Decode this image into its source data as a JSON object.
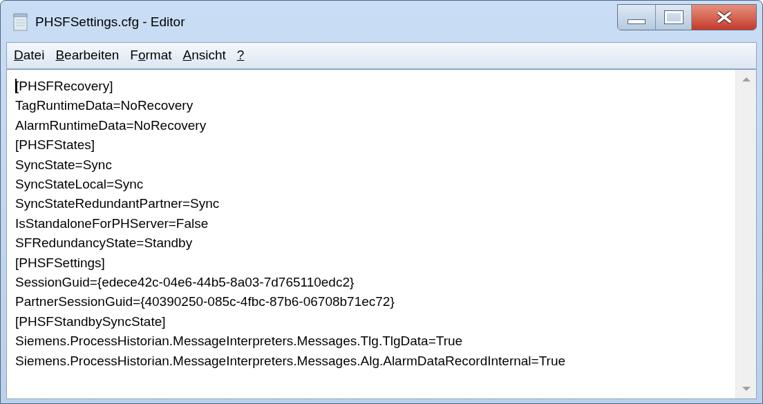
{
  "window": {
    "title": "PHSFSettings.cfg - Editor"
  },
  "menu": [
    {
      "access_key": "D",
      "label_rest": "atei"
    },
    {
      "access_key": "B",
      "label_rest": "earbeiten"
    },
    {
      "label_start": "F",
      "access_key": "o",
      "label_rest": "rmat"
    },
    {
      "access_key": "A",
      "label_rest": "nsicht"
    },
    {
      "access_key": "?"
    }
  ],
  "editor": {
    "lines": [
      "[PHSFRecovery]",
      "TagRuntimeData=NoRecovery",
      "AlarmRuntimeData=NoRecovery",
      "[PHSFStates]",
      "SyncState=Sync",
      "SyncStateLocal=Sync",
      "SyncStateRedundantPartner=Sync",
      "IsStandaloneForPHServer=False",
      "SFRedundancyState=Standby",
      "[PHSFSettings]",
      "SessionGuid={edece42c-04e6-44b5-8a03-7d765110edc2}",
      "PartnerSessionGuid={40390250-085c-4fbc-87b6-06708b71ec72}",
      "[PHSFStandbySyncState]",
      "Siemens.ProcessHistorian.MessageInterpreters.Messages.Tlg.TlgData=True",
      "Siemens.ProcessHistorian.MessageInterpreters.Messages.Alg.AlarmDataRecordInternal=True"
    ]
  }
}
